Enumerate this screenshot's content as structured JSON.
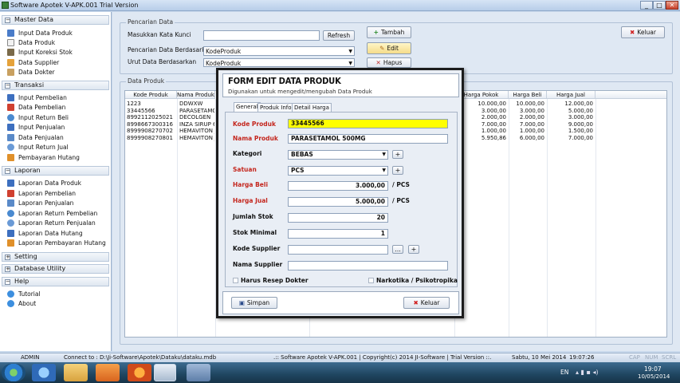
{
  "window": {
    "title": "Software Apotek V-APK.001 Trial Version",
    "controls": [
      "_",
      "□",
      "✕"
    ]
  },
  "sidebar": {
    "sections": [
      {
        "label": "Master Data",
        "sign": "−",
        "items": [
          "Input Data Produk",
          "Data Produk",
          "Input Koreksi Stok",
          "Data Supplier",
          "Data Dokter"
        ]
      },
      {
        "label": "Transaksi",
        "sign": "−",
        "items": [
          "Input Pembelian",
          "Data Pembelian",
          "Input Return Beli",
          "Input Penjualan",
          "Data Penjualan",
          "Input Return Jual",
          "Pembayaran Hutang"
        ]
      },
      {
        "label": "Laporan",
        "sign": "−",
        "items": [
          "Laporan Data Produk",
          "Laporan Pembelian",
          "Laporan Penjualan",
          "Laporan Return Pembelian",
          "Laporan Return Penjualan",
          "Laporan Data Hutang",
          "Laporan Pembayaran Hutang"
        ]
      },
      {
        "label": "Setting",
        "sign": "+",
        "items": []
      },
      {
        "label": "Database Utility",
        "sign": "+",
        "items": []
      },
      {
        "label": "Help",
        "sign": "−",
        "items": [
          "Tutorial",
          "About"
        ]
      }
    ]
  },
  "search": {
    "group_label": "Pencarian Data",
    "keyword_label": "Masukkan Kata Kunci",
    "keyword_value": "",
    "refresh": "Refresh",
    "by_label": "Pencarian Data Berdasarkan",
    "by_value": "KodeProduk",
    "sort_label": "Urut Data Berdasarkan",
    "sort_value": "KodeProduk"
  },
  "actions": {
    "tambah": "Tambah",
    "edit": "Edit",
    "hapus": "Hapus",
    "keluar": "Keluar"
  },
  "grid": {
    "group_label": "Data Produk",
    "columns": [
      "Kode Produk",
      "Nama Produk",
      "Harga Pokok",
      "Harga Beli",
      "Harga Jual"
    ],
    "rows": [
      [
        "1223",
        "DDWXW",
        "10.000,00",
        "10.000,00",
        "12.000,00"
      ],
      [
        "33445566",
        "PARASETAMO",
        "3.000,00",
        "3.000,00",
        "5.000,00"
      ],
      [
        "8992112025021",
        "DECOLGEN",
        "2.000,00",
        "2.000,00",
        "3.000,00"
      ],
      [
        "8998667300316",
        "INZA SIRUP 6",
        "7.000,00",
        "7.000,00",
        "9.000,00"
      ],
      [
        "8999908270702",
        "HEMAVITON J",
        "1.000,00",
        "1.000,00",
        "1.500,00"
      ],
      [
        "8999908270801",
        "HEMAVITON J",
        "5.950,86",
        "6.000,00",
        "7.000,00"
      ]
    ]
  },
  "dialog": {
    "title": "FORM EDIT DATA PRODUK",
    "subtitle": "Digunakan untuk mengedit/mengubah Data Produk",
    "tabs": [
      "General",
      "Produk Info",
      "Detail Harga"
    ],
    "fields": {
      "kode_label": "Kode Produk",
      "kode_value": "33445566",
      "nama_label": "Nama Produk",
      "nama_value": "PARASETAMOL 500MG",
      "kategori_label": "Kategori",
      "kategori_value": "BEBAS",
      "satuan_label": "Satuan",
      "satuan_value": "PCS",
      "beli_label": "Harga Beli",
      "beli_value": "3.000,00",
      "beli_unit": "/ PCS",
      "jual_label": "Harga Jual",
      "jual_value": "5.000,00",
      "jual_unit": "/ PCS",
      "stok_label": "Jumlah Stok",
      "stok_value": "20",
      "min_label": "Stok Minimal",
      "min_value": "1",
      "supplier_label": "Kode Supplier",
      "supplier_value": "",
      "nama_supplier_label": "Nama Supplier",
      "nama_supplier_value": "",
      "resep_label": "Harus Resep Dokter",
      "narkotika_label": "Narkotika / Psikotropika",
      "ellipsis": "...",
      "plus": "+"
    },
    "simpan": "Simpan",
    "keluar": "Keluar"
  },
  "status": {
    "user": "ADMIN",
    "connect": "Connect to : D:\\Ji-Software\\Apotek\\Dataku\\dataku.mdb",
    "app": ".:: Software Apotek V-APK.001 | Copyright(c) 2014 JI-Software | Trial Version ::.",
    "date": "Sabtu, 10 Mei 2014",
    "time": "19:07:26",
    "caps": "CAP",
    "num": "NUM",
    "scrl": "SCRL"
  },
  "taskbar": {
    "lang": "EN",
    "clock_time": "19:07",
    "clock_date": "10/05/2014"
  },
  "colors": {
    "required": "#c4261d",
    "highlight": "#ffff00",
    "keluar_icon": "#d02020"
  }
}
